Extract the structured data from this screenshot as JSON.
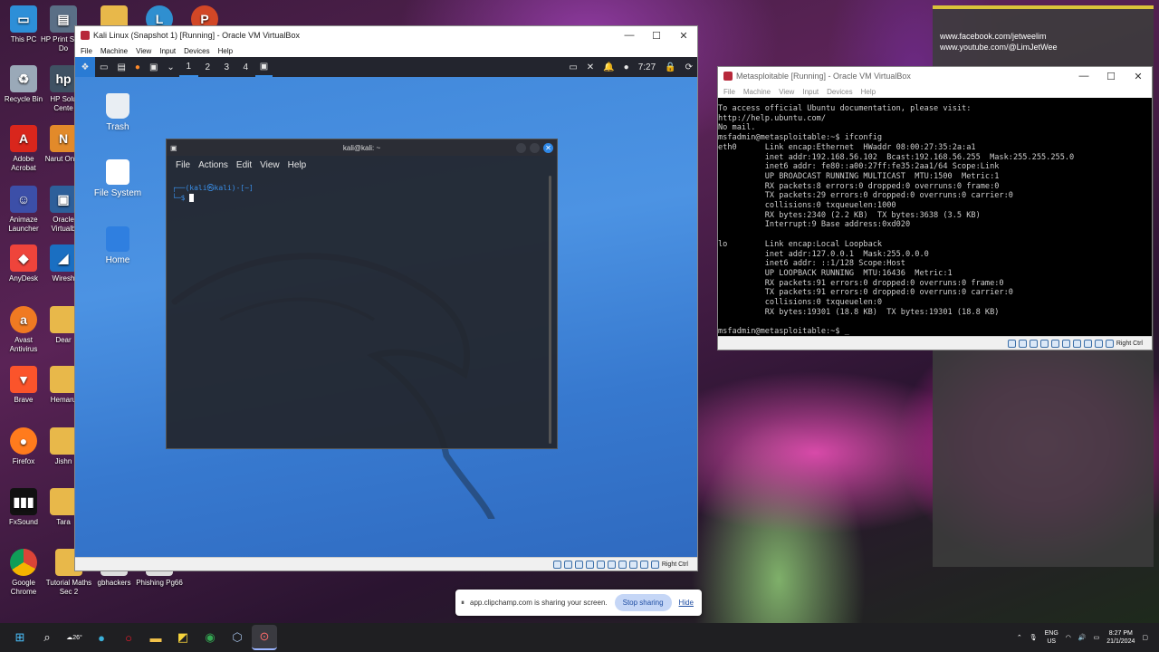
{
  "desktop": {
    "icons": [
      {
        "label": "This PC"
      },
      {
        "label": "HP Print Scan Do"
      },
      {
        "label": ""
      },
      {
        "label": ""
      },
      {
        "label": ""
      },
      {
        "label": "Recycle Bin"
      },
      {
        "label": "HP Solu Cente"
      },
      {
        "label": "Adobe Acrobat"
      },
      {
        "label": "Narut Onlin"
      },
      {
        "label": "Animaze Launcher"
      },
      {
        "label": "Oracle Virtualb"
      },
      {
        "label": "AnyDesk"
      },
      {
        "label": "Wiresh"
      },
      {
        "label": "Avast Antivirus"
      },
      {
        "label": "Dear"
      },
      {
        "label": "Brave"
      },
      {
        "label": "Hemaru"
      },
      {
        "label": "Firefox"
      },
      {
        "label": "Jishn"
      },
      {
        "label": "FxSound"
      },
      {
        "label": "Tara"
      },
      {
        "label": "Google Chrome"
      },
      {
        "label": "Tutorial Maths Sec 2"
      },
      {
        "label": "gbhackers"
      },
      {
        "label": "Phishing Pg66"
      }
    ]
  },
  "kali_window": {
    "title": "Kali Linux (Snapshot 1) [Running] - Oracle VM VirtualBox",
    "menu": [
      "File",
      "Machine",
      "View",
      "Input",
      "Devices",
      "Help"
    ],
    "status_host_key": "Right Ctrl",
    "panel": {
      "workspaces": [
        "1",
        "2",
        "3",
        "4"
      ],
      "time": "7:27"
    },
    "desktop_icons": [
      {
        "label": "Trash"
      },
      {
        "label": "File System"
      },
      {
        "label": "Home"
      }
    ],
    "terminal": {
      "title": "kali@kali: ~",
      "menu": [
        "File",
        "Actions",
        "Edit",
        "View",
        "Help"
      ],
      "prompt_line1": "┌──(kali㉿kali)-[~]",
      "prompt_line2": "└─$ "
    }
  },
  "meta_window": {
    "title": "Metasploitable [Running] - Oracle VM VirtualBox",
    "menu": [
      "File",
      "Machine",
      "View",
      "Input",
      "Devices",
      "Help"
    ],
    "status_host_key": "Right Ctrl",
    "console": "To access official Ubuntu documentation, please visit:\nhttp://help.ubuntu.com/\nNo mail.\nmsfadmin@metasploitable:~$ ifconfig\neth0      Link encap:Ethernet  HWaddr 08:00:27:35:2a:a1\n          inet addr:192.168.56.102  Bcast:192.168.56.255  Mask:255.255.255.0\n          inet6 addr: fe80::a00:27ff:fe35:2aa1/64 Scope:Link\n          UP BROADCAST RUNNING MULTICAST  MTU:1500  Metric:1\n          RX packets:8 errors:0 dropped:0 overruns:0 frame:0\n          TX packets:29 errors:0 dropped:0 overruns:0 carrier:0\n          collisions:0 txqueuelen:1000\n          RX bytes:2340 (2.2 KB)  TX bytes:3638 (3.5 KB)\n          Interrupt:9 Base address:0xd020\n\nlo        Link encap:Local Loopback\n          inet addr:127.0.0.1  Mask:255.0.0.0\n          inet6 addr: ::1/128 Scope:Host\n          UP LOOPBACK RUNNING  MTU:16436  Metric:1\n          RX packets:91 errors:0 dropped:0 overruns:0 frame:0\n          TX packets:91 errors:0 dropped:0 overruns:0 carrier:0\n          collisions:0 txqueuelen:0\n          RX bytes:19301 (18.8 KB)  TX bytes:19301 (18.8 KB)\n\nmsfadmin@metasploitable:~$ _"
  },
  "social": {
    "facebook": "www.facebook.com/jetweelim",
    "youtube": "www.youtube.com/@LimJetWee"
  },
  "share_bar": {
    "message": "app.clipchamp.com is sharing your screen.",
    "stop_label": "Stop sharing",
    "hide_label": "Hide"
  },
  "taskbar": {
    "weather_temp": "26°",
    "lang": "ENG",
    "region": "US",
    "time": "8:27 PM",
    "date": "21/1/2024"
  }
}
